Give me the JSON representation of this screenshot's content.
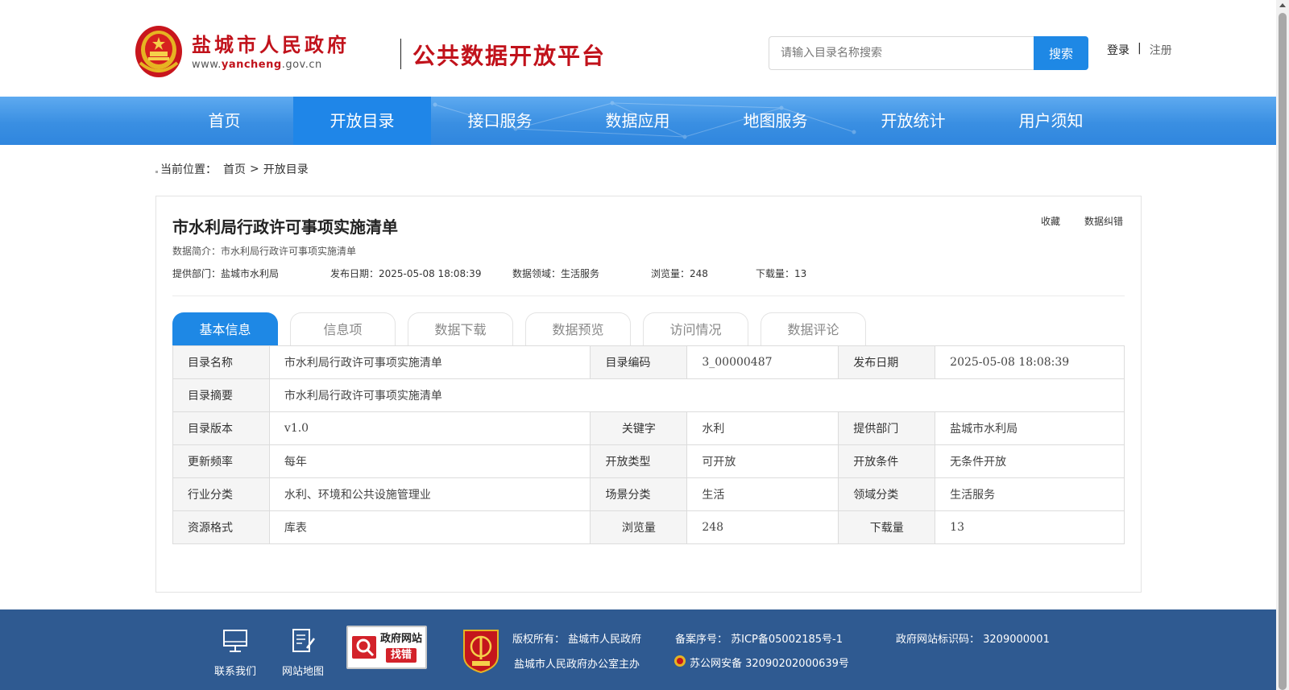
{
  "header": {
    "logo_cn": "盐城市人民政府",
    "logo_url_prefix": "www.",
    "logo_url_bold": "yancheng",
    "logo_url_suffix": ".gov.cn",
    "platform_title": "公共数据开放平台",
    "search_placeholder": "请输入目录名称搜索",
    "search_button": "搜索",
    "login": "登录",
    "separator": "|",
    "register": "注册"
  },
  "nav": {
    "items": [
      {
        "label": "首页"
      },
      {
        "label": "开放目录"
      },
      {
        "label": "接口服务"
      },
      {
        "label": "数据应用"
      },
      {
        "label": "地图服务"
      },
      {
        "label": "开放统计"
      },
      {
        "label": "用户须知"
      }
    ],
    "active_index": 1
  },
  "breadcrumb": {
    "label": "当前位置：",
    "home": "首页",
    "sep": ">",
    "current": "开放目录"
  },
  "card": {
    "title": "市水利局行政许可事项实施清单",
    "actions": {
      "favorite": "收藏",
      "correction": "数据纠错"
    },
    "description": "数据简介：市水利局行政许可事项实施清单",
    "meta": {
      "dept": "提供部门：盐城市水利局",
      "date": "发布日期：2025-05-08 18:08:39",
      "domain": "数据领域：生活服务",
      "views": "浏览量：248",
      "downloads": "下载量：13"
    }
  },
  "tabs": [
    {
      "label": "基本信息"
    },
    {
      "label": "信息项"
    },
    {
      "label": "数据下载"
    },
    {
      "label": "数据预览"
    },
    {
      "label": "访问情况"
    },
    {
      "label": "数据评论"
    }
  ],
  "info_table": {
    "r1": {
      "k1": "目录名称",
      "v1": "市水利局行政许可事项实施清单",
      "k2": "目录编码",
      "v2": "3_00000487",
      "k3": "发布日期",
      "v3": "2025-05-08 18:08:39"
    },
    "r2": {
      "k1": "目录摘要",
      "v1": "市水利局行政许可事项实施清单"
    },
    "r3": {
      "k1": "目录版本",
      "v1": "v1.0",
      "k2": "关键字",
      "v2": "水利",
      "k3": "提供部门",
      "v3": "盐城市水利局"
    },
    "r4": {
      "k1": "更新频率",
      "v1": "每年",
      "k2": "开放类型",
      "v2": "可开放",
      "k3": "开放条件",
      "v3": "无条件开放"
    },
    "r5": {
      "k1": "行业分类",
      "v1": "水利、环境和公共设施管理业",
      "k2": "场景分类",
      "v2": "生活",
      "k3": "领域分类",
      "v3": "生活服务"
    },
    "r6": {
      "k1": "资源格式",
      "v1": "库表",
      "k2": "浏览量",
      "v2": "248",
      "k3": "下载量",
      "v3": "13"
    }
  },
  "footer": {
    "contact": "联系我们",
    "sitemap": "网站地图",
    "gov_badge_line1": "政府网站",
    "gov_badge_line2": "找错",
    "copyright": "版权所有： 盐城市人民政府",
    "host": "盐城市人民政府办公室主办",
    "icp": "备案序号： 苏ICP备05002185号-1",
    "police": "苏公网安备 32090202000639号",
    "site_code": "政府网站标识码： 3209000001"
  },
  "colors": {
    "brand_red": "#c1121b",
    "primary_blue": "#1e88e5",
    "footer_blue": "#2f5a91"
  }
}
